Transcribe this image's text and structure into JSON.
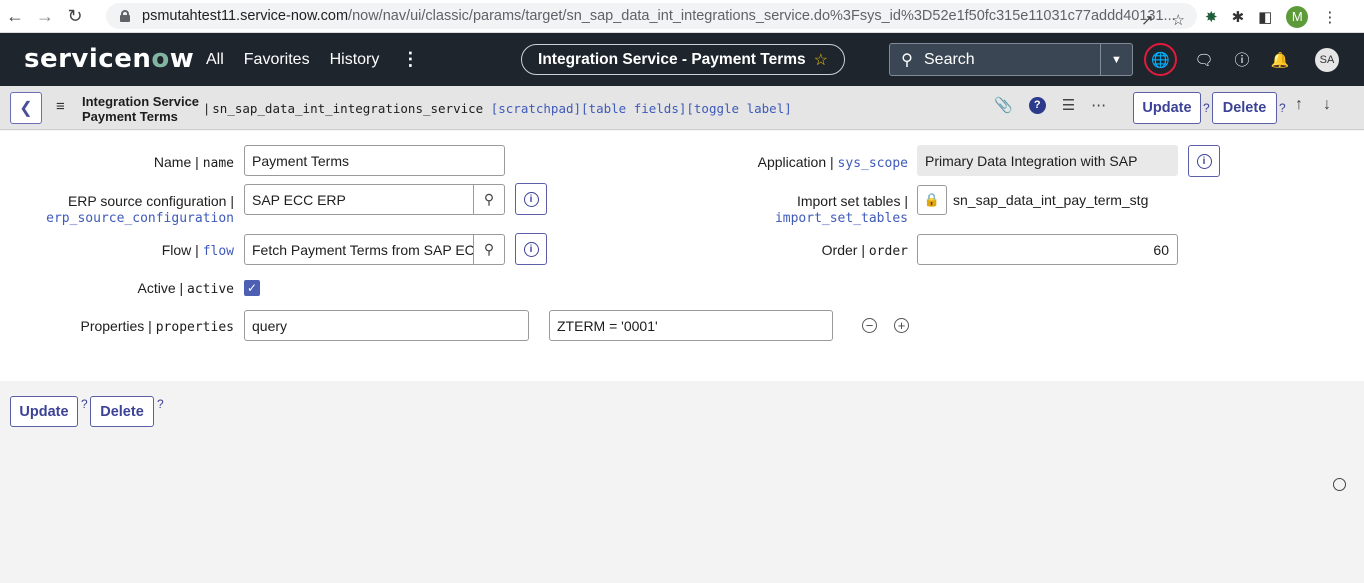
{
  "browser": {
    "url_host": "psmutahtest11.service-now.com",
    "url_path": "/now/nav/ui/classic/params/target/sn_sap_data_int_integrations_service.do%3Fsys_id%3D52e1f50fc315e11031c77addd40131...",
    "profile_initial": "M"
  },
  "header": {
    "logo": "servicenow",
    "nav": [
      "All",
      "Favorites",
      "History"
    ],
    "context_title": "Integration Service - Payment Terms",
    "search_placeholder": "Search",
    "user_initials": "SA"
  },
  "formbar": {
    "title_line1": "Integration Service",
    "title_line2": "Payment Terms",
    "table_name": "sn_sap_data_int_integrations_service",
    "links": "[scratchpad][table fields][toggle label]",
    "update_label": "Update",
    "delete_label": "Delete",
    "help": "?"
  },
  "form": {
    "name": {
      "label": "Name",
      "tech": "name",
      "value": "Payment Terms"
    },
    "erp": {
      "label": "ERP source configuration",
      "tech": "erp_source_configuration",
      "value": "SAP ECC ERP"
    },
    "flow": {
      "label": "Flow",
      "tech": "flow",
      "value": "Fetch Payment Terms from SAP ECC"
    },
    "active": {
      "label": "Active",
      "tech": "active",
      "checked": true
    },
    "properties": {
      "label": "Properties",
      "tech": "properties",
      "key": "query",
      "value": "ZTERM = '0001'"
    },
    "application": {
      "label": "Application",
      "tech": "sys_scope",
      "value": "Primary Data Integration with SAP"
    },
    "import_set": {
      "label": "Import set tables",
      "tech": "import_set_tables",
      "value": "sn_sap_data_int_pay_term_stg"
    },
    "order": {
      "label": "Order",
      "tech": "order",
      "value": "60"
    }
  },
  "footer": {
    "update_label": "Update",
    "delete_label": "Delete",
    "help": "?"
  }
}
